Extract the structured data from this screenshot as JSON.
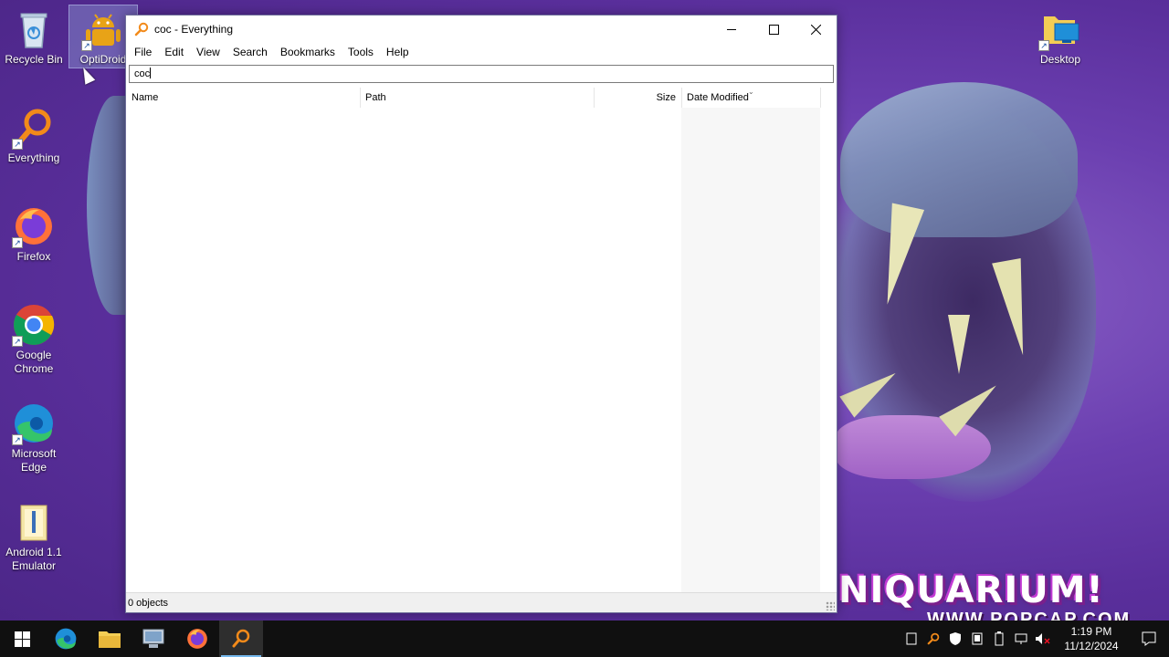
{
  "desktop": {
    "icons": [
      {
        "label": "Recycle Bin"
      },
      {
        "label": "OptiDroid"
      },
      {
        "label": "Everything"
      },
      {
        "label": "Firefox"
      },
      {
        "label": "Google Chrome"
      },
      {
        "label": "Microsoft Edge"
      },
      {
        "label": "Android 1.1 Emulator"
      },
      {
        "label": "Desktop"
      }
    ],
    "wallpaper": {
      "title": "NIQUARIUM!",
      "url": "WWW.POPCAP.COM"
    }
  },
  "window": {
    "title": "coc - Everything",
    "menu": [
      "File",
      "Edit",
      "View",
      "Search",
      "Bookmarks",
      "Tools",
      "Help"
    ],
    "search_value": "coc",
    "columns": [
      "Name",
      "Path",
      "Size",
      "Date Modified"
    ],
    "status": "0 objects"
  },
  "taskbar": {
    "clock_time": "1:19 PM",
    "clock_date": "11/12/2024"
  },
  "colors": {
    "accent": "#76b9ed",
    "wallpaper": "#6b3fb0",
    "taskbar": "#101010"
  }
}
